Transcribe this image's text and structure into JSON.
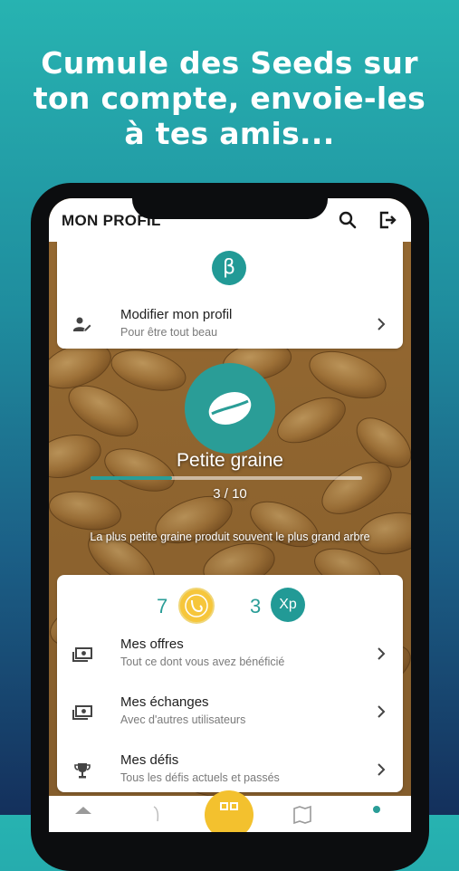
{
  "headline": {
    "line1": "Cumule des Seeds sur",
    "line2": "ton compte, envoie-les",
    "line3": "à tes amis..."
  },
  "appbar": {
    "title": "MON PROFIL",
    "search_icon": "search-icon",
    "logout_icon": "logout-icon"
  },
  "profile": {
    "logo_letter": "β",
    "edit_row": {
      "title": "Modifier mon profil",
      "subtitle": "Pour être tout beau",
      "icon": "edit-user-icon"
    }
  },
  "level": {
    "name": "Petite graine",
    "current": 3,
    "max": 10,
    "progress_text": "3 / 10",
    "progress_fraction": 0.3,
    "quote": "La plus petite graine produit souvent le plus grand arbre"
  },
  "stats": {
    "seeds": "7",
    "xp": "3",
    "xp_label": "Xp"
  },
  "menu": [
    {
      "title": "Mes offres",
      "subtitle": "Tout ce dont vous avez bénéficié",
      "icon": "money-icon"
    },
    {
      "title": "Mes échanges",
      "subtitle": "Avec d'autres utilisateurs",
      "icon": "money-icon"
    },
    {
      "title": "Mes défis",
      "subtitle": "Tous les défis actuels et passés",
      "icon": "trophy-icon"
    }
  ],
  "colors": {
    "teal": "#2a9d97",
    "coin": "#f6c63b",
    "background_top": "#27b3b1",
    "background_bottom": "#14305c"
  }
}
